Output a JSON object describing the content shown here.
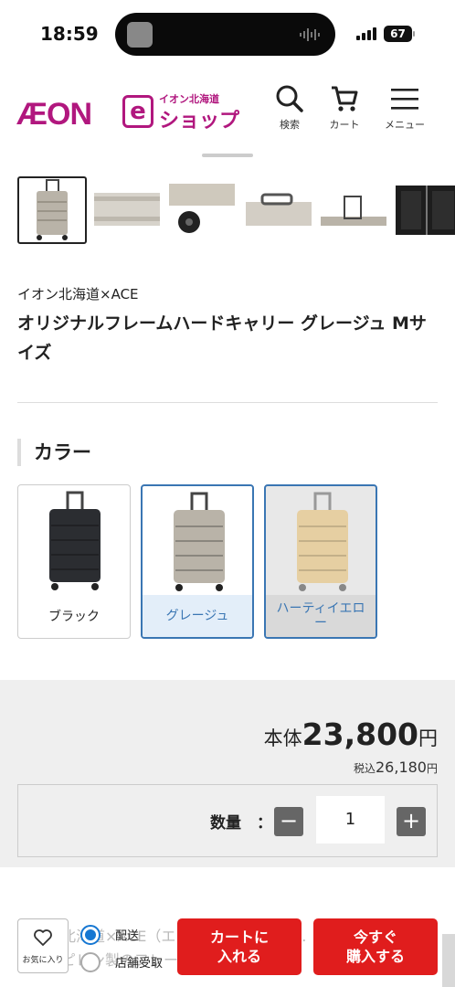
{
  "status_bar": {
    "time": "18:59",
    "battery": "67"
  },
  "header": {
    "logo_main": "ÆON",
    "logo_e": "e",
    "logo_sub": "イオン北海道",
    "logo_shop": "ショップ",
    "search_label": "検索",
    "cart_label": "カート",
    "menu_label": "メニュー"
  },
  "product": {
    "brand": "イオン北海道×ACE",
    "title": "オリジナルフレームハードキャリー グレージュ Mサイズ"
  },
  "color_section": {
    "heading": "カラー",
    "options": [
      {
        "label": "ブラック",
        "color": "#2b2d31"
      },
      {
        "label": "グレージュ",
        "color": "#b9b3a8"
      },
      {
        "label": "ハーティイエロー",
        "color": "#e6cfa2"
      }
    ],
    "selected": "グレージュ"
  },
  "price": {
    "prefix": "本体",
    "amount": "23,800",
    "unit": "円",
    "tax_prefix": "税込",
    "tax_amount": "26,180",
    "tax_unit": "円"
  },
  "quantity": {
    "label": "数量　：",
    "value": "1",
    "minus": "−",
    "plus": "+"
  },
  "description": "イオン北海道×ACE（エース）の共同企画… ・軽くて丈夫なポリプロピレン製のフレームタイプの…",
  "bottom_bar": {
    "favorite_label": "お気に入り",
    "delivery_label": "配送",
    "store_pickup_label": "店舗受取",
    "add_to_cart_label": "カートに\n入れる",
    "buy_now_label": "今すぐ\n購入する"
  },
  "colors": {
    "brand": "#b1177e",
    "accent_blue": "#3a76b3",
    "cta_red": "#e01d1d"
  }
}
